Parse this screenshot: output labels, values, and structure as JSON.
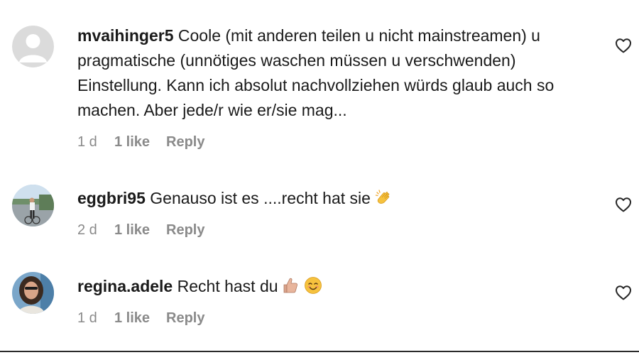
{
  "comments": [
    {
      "username": "mvaihinger5",
      "text": "Coole (mit anderen teilen u nicht mainstreamen) u pragmatische (unnötiges waschen müssen u verschwenden) Einstellung. Kann ich absolut nachvollziehen würds glaub auch so machen. Aber jede/r wie er/sie mag...",
      "time": "1 d",
      "likes": "1 like",
      "reply": "Reply",
      "avatar": "default-avatar-icon"
    },
    {
      "username": "eggbri95",
      "text": "Genauso ist es ....recht hat sie",
      "emoji": [
        "clapping-hands-emoji"
      ],
      "time": "2 d",
      "likes": "1 like",
      "reply": "Reply",
      "avatar": "photo-avatar-cyclist"
    },
    {
      "username": "regina.adele",
      "text": "Recht hast du",
      "emoji": [
        "thumbs-up-emoji",
        "smiling-face-emoji"
      ],
      "time": "1 d",
      "likes": "1 like",
      "reply": "Reply",
      "avatar": "photo-avatar-woman"
    }
  ],
  "icons": {
    "like": "heart-outline-icon"
  },
  "colors": {
    "text": "#1a1a1a",
    "meta": "#8a8a8a",
    "background": "#ffffff"
  }
}
